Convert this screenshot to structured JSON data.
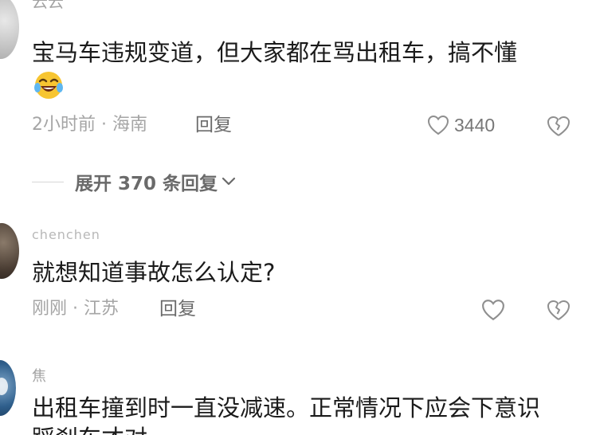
{
  "comments": [
    {
      "username": "云云",
      "text": "宝马车违规变道，但大家都在骂出租车，搞不懂",
      "emoji": "laughing-crying-emoji",
      "meta": "2小时前 · 海南",
      "reply_label": "回复",
      "like_count": "3440",
      "expand_label": "展开 370 条回复"
    },
    {
      "username": "chenchen",
      "text": "就想知道事故怎么认定?",
      "meta": "刚刚 · 江苏",
      "reply_label": "回复"
    },
    {
      "username": "焦",
      "text": "出租车撞到时一直没减速。正常情况下应会下意识",
      "text_line2": "踩刹车才对"
    }
  ],
  "colors": {
    "text": "#1b1b1b",
    "meta": "#a5a5a5",
    "icon": "#9a9a9a"
  }
}
